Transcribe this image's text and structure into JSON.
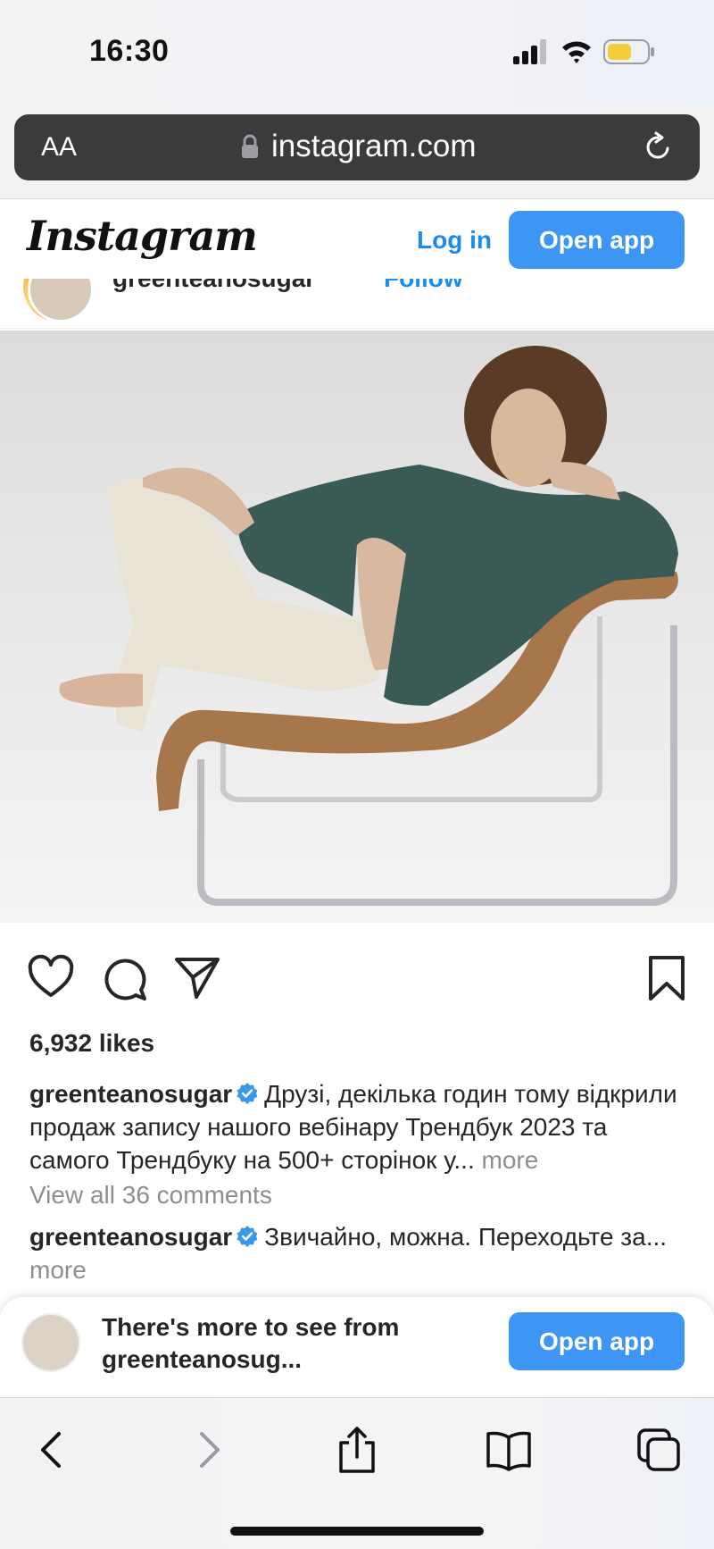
{
  "status_bar": {
    "time": "16:30"
  },
  "address_bar": {
    "aa_label": "AA",
    "url": "instagram.com"
  },
  "ig_header": {
    "logo": "Instagram",
    "login_label": "Log in",
    "open_app_label": "Open app"
  },
  "post": {
    "username": "greenteanosugar",
    "follow_label": "Follow",
    "likes_text": "6,932 likes",
    "caption_text": "Друзі, декілька годин тому відкрили продаж запису нашого вебінару Трендбук 2023 та самого Трендбуку на 500+ сторінок у...",
    "more_label": "more",
    "view_all_comments": "View all 36 comments",
    "comment": {
      "username": "greenteanosugar",
      "text": "Звичайно, можна. Переходьте за...",
      "more_label": "more"
    }
  },
  "banner": {
    "text": "There's more to see from greenteanosug...",
    "open_app_label": "Open app"
  },
  "colors": {
    "accent": "#3d96f3",
    "link": "#1a8cf0",
    "muted": "#8e8e8e",
    "text": "#262626"
  },
  "icons": [
    "cellular-signal-icon",
    "wifi-icon",
    "battery-icon",
    "lock-icon",
    "reload-icon",
    "verified-badge-icon",
    "heart-icon",
    "comment-icon",
    "share-icon",
    "bookmark-icon",
    "back-icon",
    "forward-icon",
    "share-sheet-icon",
    "bookmarks-icon",
    "tabs-icon"
  ]
}
